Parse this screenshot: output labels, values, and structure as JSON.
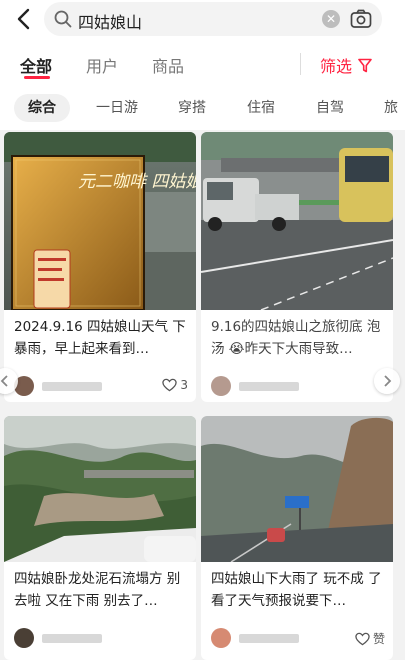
{
  "search": {
    "query": "四姑娘山"
  },
  "tabs": [
    {
      "label": "全部",
      "active": true
    },
    {
      "label": "用户",
      "active": false
    },
    {
      "label": "商品",
      "active": false
    }
  ],
  "filter": {
    "label": "筛选"
  },
  "chips": [
    {
      "label": "综合",
      "active": true
    },
    {
      "label": "一日游"
    },
    {
      "label": "穿搭"
    },
    {
      "label": "住宿"
    },
    {
      "label": "自驾"
    },
    {
      "label": "旅"
    }
  ],
  "cards": [
    {
      "title": "2024.9.16 四姑娘山天气 下暴雨，早上起来看到…",
      "likes": "3",
      "photo": {
        "sign_text": "元二咖啡 四姑娘山 Wherever"
      }
    },
    {
      "title": "9.16的四姑娘山之旅彻底 泡汤 😭昨天下大雨导致…",
      "likes": ""
    },
    {
      "title": "四姑娘卧龙处泥石流塌方 别去啦 又在下雨 别去了…",
      "likes": ""
    },
    {
      "title": "四姑娘山下大雨了 玩不成 了 看了天气预报说要下…",
      "likes": "赞"
    }
  ],
  "colors": {
    "accent": "#ff2442"
  }
}
